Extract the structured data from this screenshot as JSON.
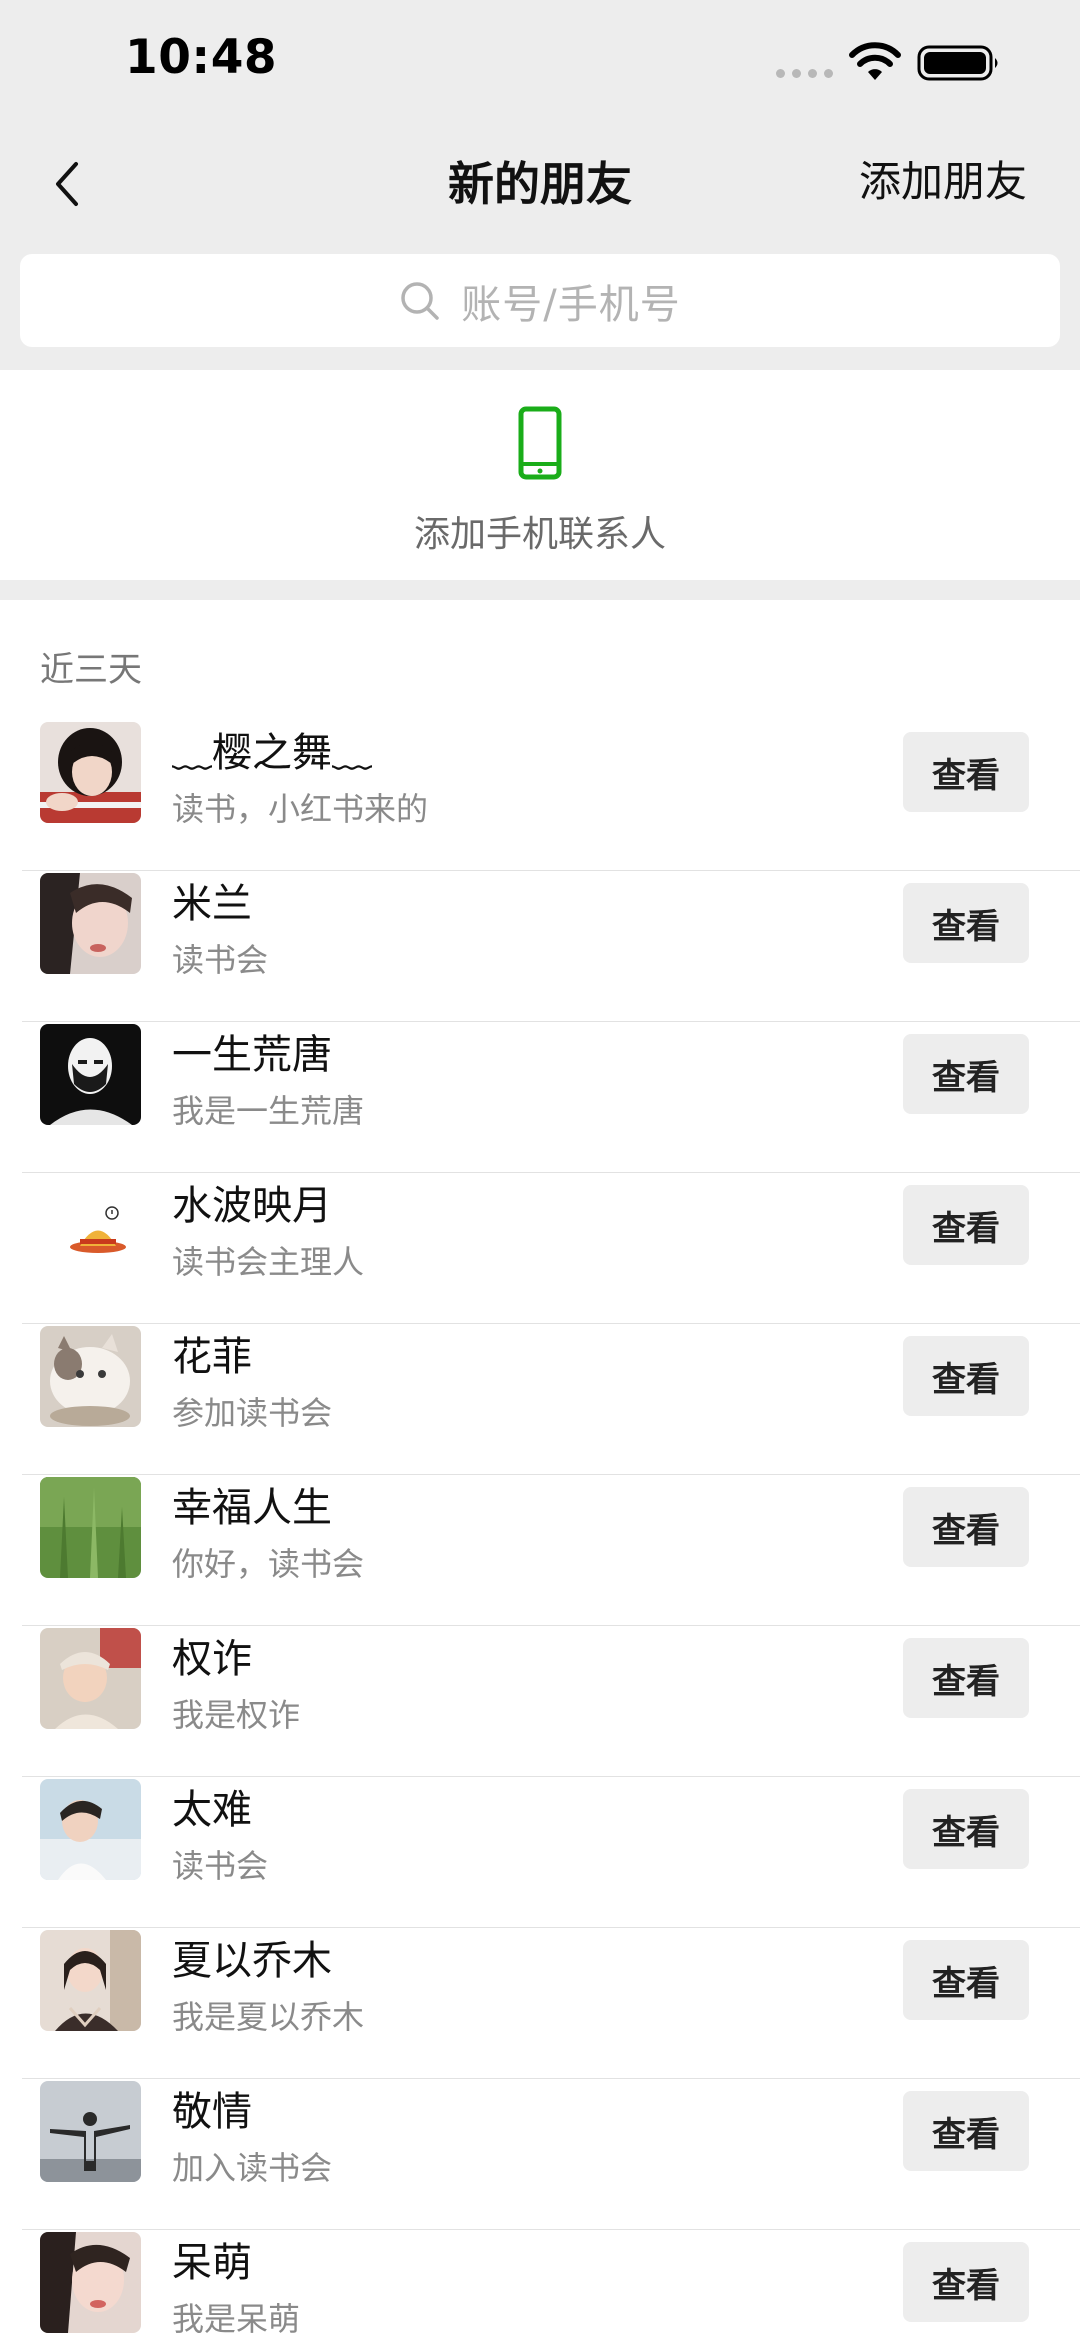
{
  "status_bar": {
    "time": "10:48"
  },
  "nav": {
    "title": "新的朋友",
    "add_friend": "添加朋友"
  },
  "search": {
    "placeholder": "账号/手机号"
  },
  "phone_contacts": {
    "label": "添加手机联系人",
    "icon": "phone-icon",
    "accent_color": "#1aad19"
  },
  "recent": {
    "header": "近三天",
    "friends": [
      {
        "name": "﹏樱之舞﹏",
        "note": "读书，小红书来的",
        "button": "查看"
      },
      {
        "name": "米兰",
        "note": "读书会",
        "button": "查看"
      },
      {
        "name": "一生荒唐",
        "note": "我是一生荒唐",
        "button": "查看"
      },
      {
        "name": "水波映月",
        "note": "读书会主理人",
        "button": "查看"
      },
      {
        "name": "花菲",
        "note": "参加读书会",
        "button": "查看"
      },
      {
        "name": "幸福人生",
        "note": "你好，读书会",
        "button": "查看"
      },
      {
        "name": "权诈",
        "note": "我是权诈",
        "button": "查看"
      },
      {
        "name": "太难",
        "note": "读书会",
        "button": "查看"
      },
      {
        "name": "夏以乔木",
        "note": "我是夏以乔木",
        "button": "查看"
      },
      {
        "name": "敬情",
        "note": "加入读书会",
        "button": "查看"
      },
      {
        "name": "呆萌",
        "note": "我是呆萌",
        "button": "查看"
      }
    ]
  }
}
